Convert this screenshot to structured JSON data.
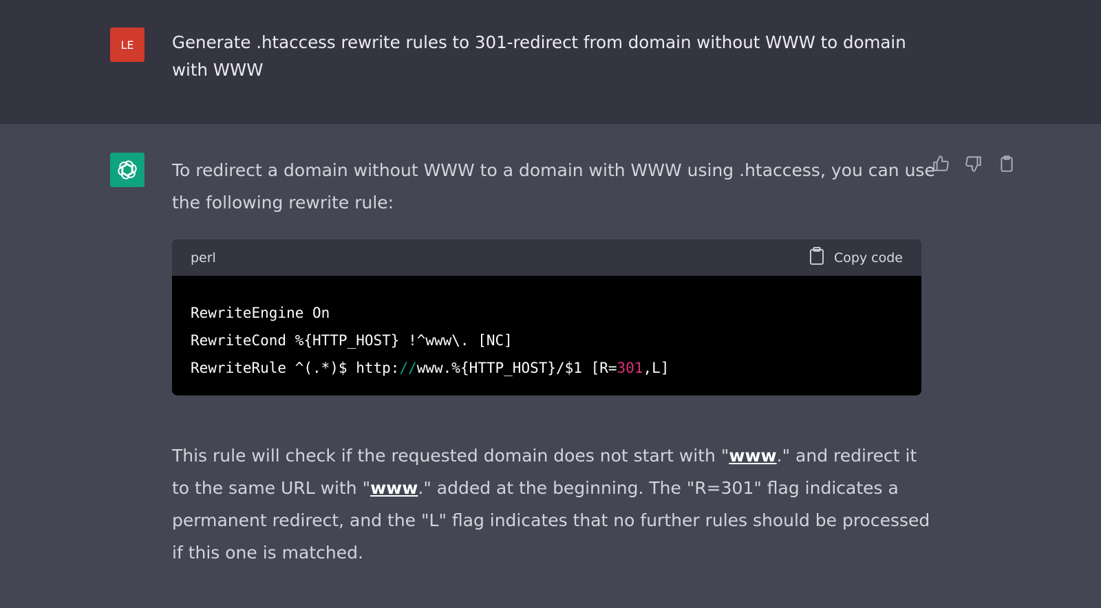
{
  "user_message": {
    "avatar_initials": "LE",
    "text": "Generate .htaccess rewrite rules to 301-redirect from domain without WWW to domain with WWW"
  },
  "assistant_message": {
    "intro": "To redirect a domain without WWW to a domain with WWW using .htaccess, you can use the following rewrite rule:",
    "code_block": {
      "language": "perl",
      "copy_label": "Copy code",
      "line1": "RewriteEngine On",
      "line2": "RewriteCond %{HTTP_HOST} !^www\\. [NC]",
      "line3_a": "RewriteRule ^(.*)$ http:",
      "line3_slashes": "//",
      "line3_b": "www.%{HTTP_HOST}/$1 [R=",
      "line3_num": "301",
      "line3_c": ",L]"
    },
    "explanation": {
      "p1": "This rule will check if the requested domain does not start with \"",
      "link1": "www",
      "p2": ".\" and redirect it to the same URL with \"",
      "link2": "www",
      "p3": ".\" added at the beginning. The \"R=301\" flag indicates a permanent redirect, and the \"L\" flag indicates that no further rules should be processed if this one is matched."
    }
  },
  "icons": {
    "assistant_avatar": "openai-logo-icon",
    "thumbs_up": "thumbs-up-icon",
    "thumbs_down": "thumbs-down-icon",
    "clipboard": "clipboard-icon"
  },
  "colors": {
    "user_avatar_bg": "#d03b2b",
    "assistant_avatar_bg": "#10a37f",
    "page_bg_user": "#343541",
    "page_bg_assistant": "#444654",
    "code_bg": "#000000"
  }
}
